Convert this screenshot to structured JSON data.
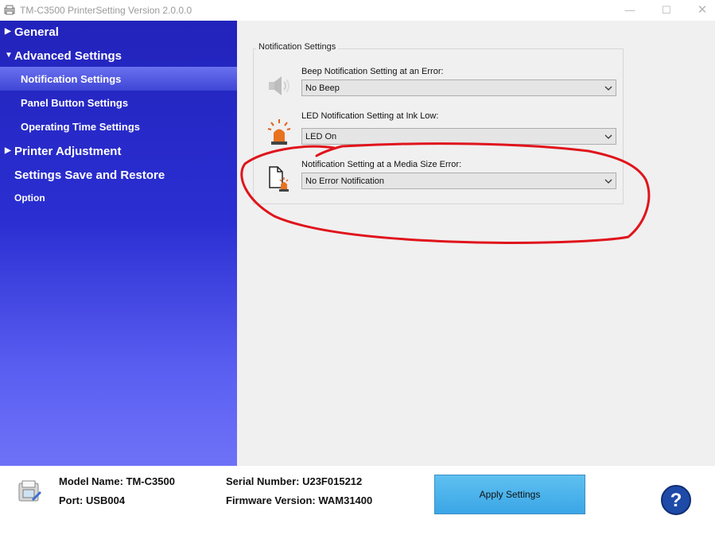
{
  "window": {
    "title": "TM-C3500 PrinterSetting Version 2.0.0.0",
    "minimize": "—",
    "maximize": "☐",
    "close": "✕"
  },
  "sidebar": {
    "items": [
      {
        "label": "General",
        "arrow": "▶"
      },
      {
        "label": "Advanced Settings",
        "arrow": "▼"
      },
      {
        "label": "Notification Settings",
        "selected": true
      },
      {
        "label": "Panel Button Settings"
      },
      {
        "label": "Operating Time Settings"
      },
      {
        "label": "Printer Adjustment",
        "arrow": "▶"
      },
      {
        "label": "Settings Save and Restore"
      },
      {
        "label": "Option"
      }
    ]
  },
  "content": {
    "group_title": "Notification Settings",
    "settings": [
      {
        "label": "Beep Notification Setting at an Error:",
        "value": "No Beep",
        "icon": "speaker-icon"
      },
      {
        "label": "LED Notification Setting at Ink Low:",
        "value": "LED On",
        "icon": "alarm-light-icon"
      },
      {
        "label": "Notification Setting at a Media Size Error:",
        "value": "No Error Notification",
        "icon": "media-size-alert-icon"
      }
    ]
  },
  "footer": {
    "model_name": "Model Name: TM-C3500",
    "port": "Port: USB004",
    "serial_number": "Serial Number: U23F015212",
    "firmware_version": "Firmware Version: WAM31400",
    "apply_label": "Apply Settings",
    "help_glyph": "?"
  },
  "colors": {
    "sidebar_top": "#2223bb",
    "sidebar_bottom": "#6e72f7",
    "annotation": "#e0141c",
    "apply_button": "#3aa6e6",
    "help_button": "#1e4aa8"
  }
}
